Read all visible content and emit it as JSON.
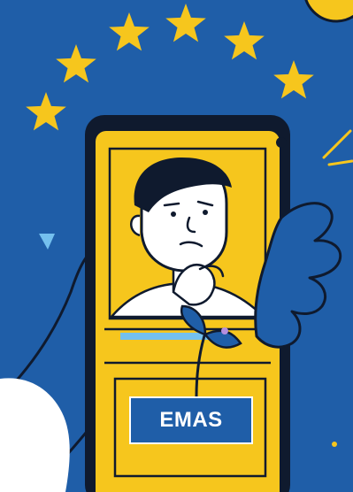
{
  "badge": {
    "label": "EMAS"
  },
  "colors": {
    "background": "#1f5ea8",
    "star": "#f6c61d",
    "phone_body": "#f6c61d",
    "outline": "#0f1a2e",
    "badge": "#1f5ea8",
    "hand": "#1f5ea8",
    "sun": "#f6c61d",
    "cloud": "#ffffff"
  },
  "icons": [
    "star-icon",
    "smartphone-icon",
    "thinking-man-icon",
    "sprout-icon",
    "hand-icon"
  ]
}
